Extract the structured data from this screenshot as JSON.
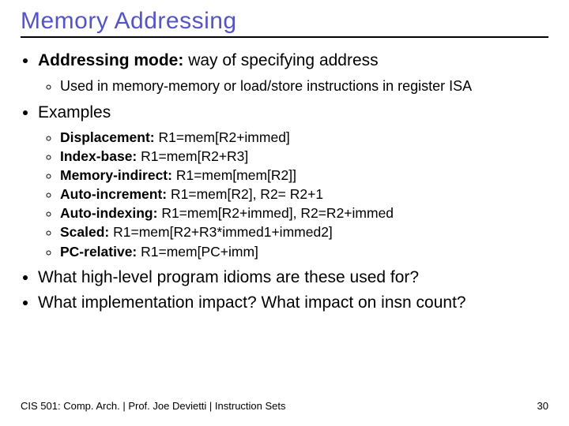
{
  "title": "Memory Addressing",
  "bullets": {
    "b1_label": "Addressing mode:",
    "b1_rest": " way of specifying address",
    "b1_sub1": "Used in memory-memory or load/store instructions in register ISA",
    "b2": "Examples",
    "ex1_label": "Displacement:",
    "ex1_rest": "  R1=mem[R2+immed]",
    "ex2_label": "Index-base:",
    "ex2_rest": "  R1=mem[R2+R3]",
    "ex3_label": "Memory-indirect:",
    "ex3_rest": " R1=mem[mem[R2]]",
    "ex4_label": "Auto-increment:",
    "ex4_rest": " R1=mem[R2], R2= R2+1",
    "ex5_label": "Auto-indexing:",
    "ex5_rest": " R1=mem[R2+immed], R2=R2+immed",
    "ex6_label": "Scaled:",
    "ex6_rest": "  R1=mem[R2+R3*immed1+immed2]",
    "ex7_label": "PC-relative:",
    "ex7_rest": " R1=mem[PC+imm]",
    "b3": "What high-level program idioms are these used for?",
    "b4": "What implementation impact? What impact on insn count?"
  },
  "footer": {
    "left": "CIS 501: Comp. Arch.  |  Prof. Joe Devietti  |  Instruction Sets",
    "right": "30"
  }
}
